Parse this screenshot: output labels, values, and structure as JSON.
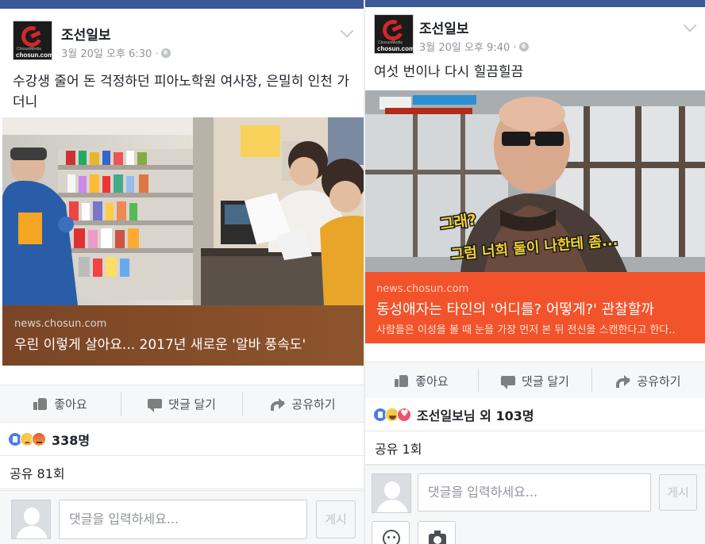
{
  "posts": [
    {
      "page_name": "조선일보",
      "logo_small_text": "ChosunMedia",
      "logo_text": "chosun.com",
      "time": "3월 20일 오후 6:30 ·",
      "text": "수강생 줄어 돈 걱정하던 피아노학원 여사장, 은밀히 인천 가더니",
      "link": {
        "domain": "news.chosun.com",
        "title": "우린 이렇게 살아요... 2017년 새로운 '알바 풍속도'",
        "description": ""
      },
      "actions": [
        "좋아요",
        "댓글 달기",
        "공유하기"
      ],
      "reaction_icons": [
        "like",
        "sad",
        "angry"
      ],
      "reaction_count": "338명",
      "shares": "공유 81회",
      "comment_placeholder": "댓글을 입력하세요...",
      "post_button": "게시"
    },
    {
      "page_name": "조선일보",
      "logo_small_text": "ChosunMedia",
      "logo_text": "chosun.com",
      "time": "3월 20일 오후 9:40 ·",
      "text": "여섯 번이나 다시 힐끔힐끔",
      "link": {
        "domain": "news.chosun.com",
        "title": "동성애자는 타인의 '어디를? 어떻게?' 관찰할까",
        "description": "사람들은 이성을 볼 때 눈을 가장 먼저 본 뒤 전신을 스캔한다고 한다.."
      },
      "image_caption_1": "그래?",
      "image_caption_2": "그럼 너희 둘이 나한테 좀...",
      "actions": [
        "좋아요",
        "댓글 달기",
        "공유하기"
      ],
      "reaction_icons": [
        "like",
        "haha",
        "love"
      ],
      "reaction_count": "조선일보님 외 103명",
      "shares": "공유 1회",
      "comment_placeholder": "댓글을 입력하세요...",
      "post_button": "게시"
    }
  ],
  "colors": {
    "facebook_blue": "#3b5998",
    "link_box_left": "#7a4526",
    "link_box_right": "#f2532b",
    "text": "#1d2129",
    "meta_gray": "#90949c"
  }
}
